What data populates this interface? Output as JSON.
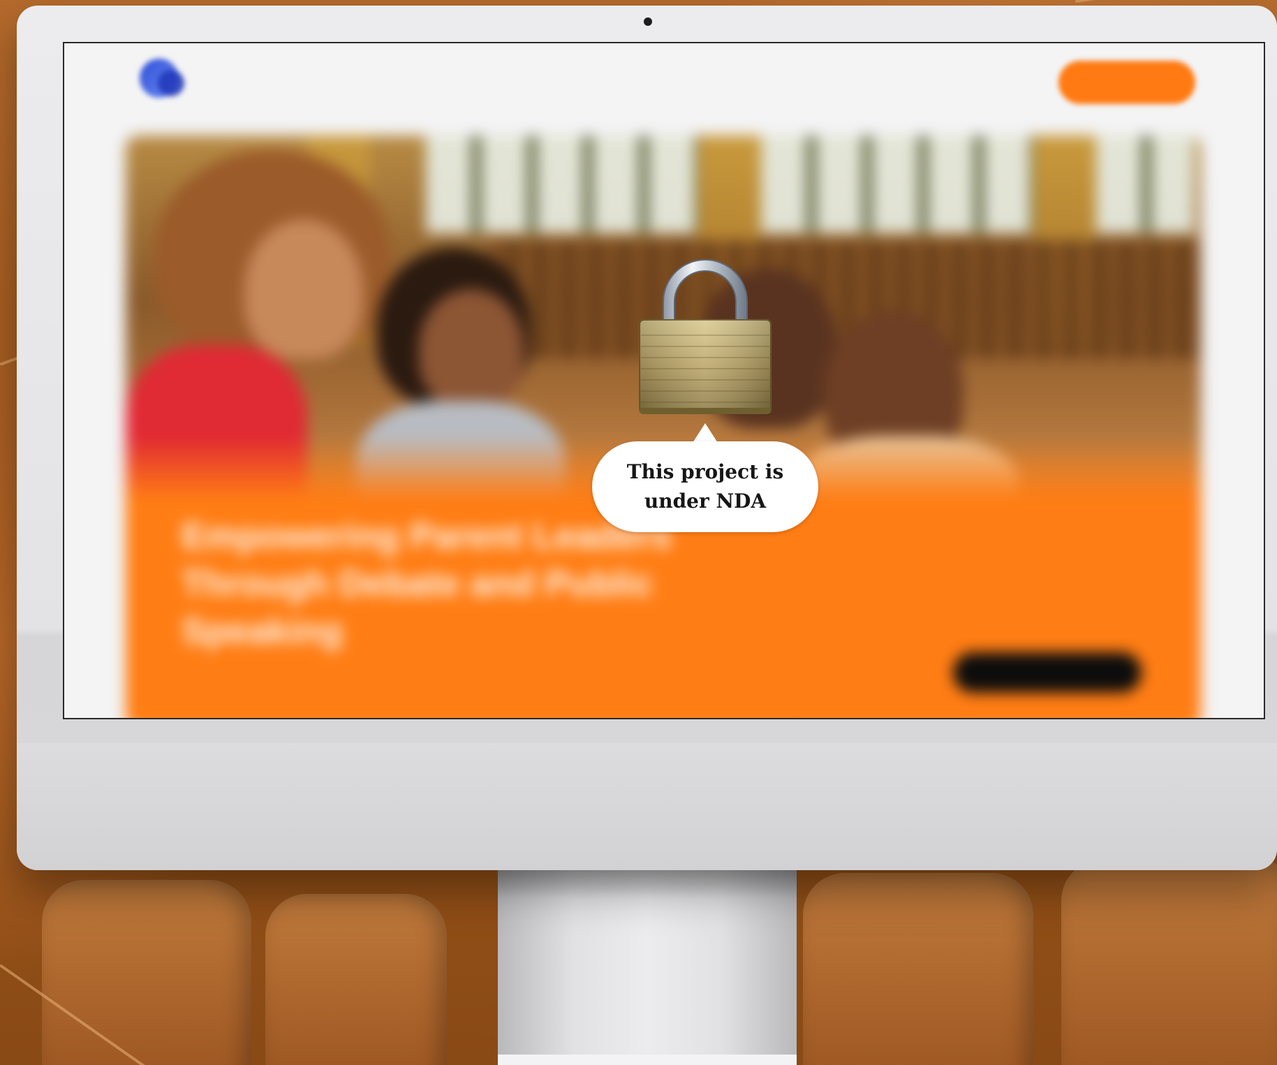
{
  "overlay": {
    "message": "This project is under NDA",
    "icon": "padlock-icon"
  },
  "website": {
    "logo_text": "",
    "nav_links": [
      "",
      "",
      "",
      ""
    ],
    "cta_label": "",
    "hero": {
      "title": "Empowering Parent Leaders Through Debate and Public Speaking",
      "subtitle": "",
      "button_label": ""
    }
  },
  "colors": {
    "brand_orange": "#ff7d14",
    "cta_orange": "#ff7a12",
    "logo_blue": "#2f4fd8",
    "hero_button": "#0d0d0d",
    "backdrop": "#a35a1c"
  }
}
